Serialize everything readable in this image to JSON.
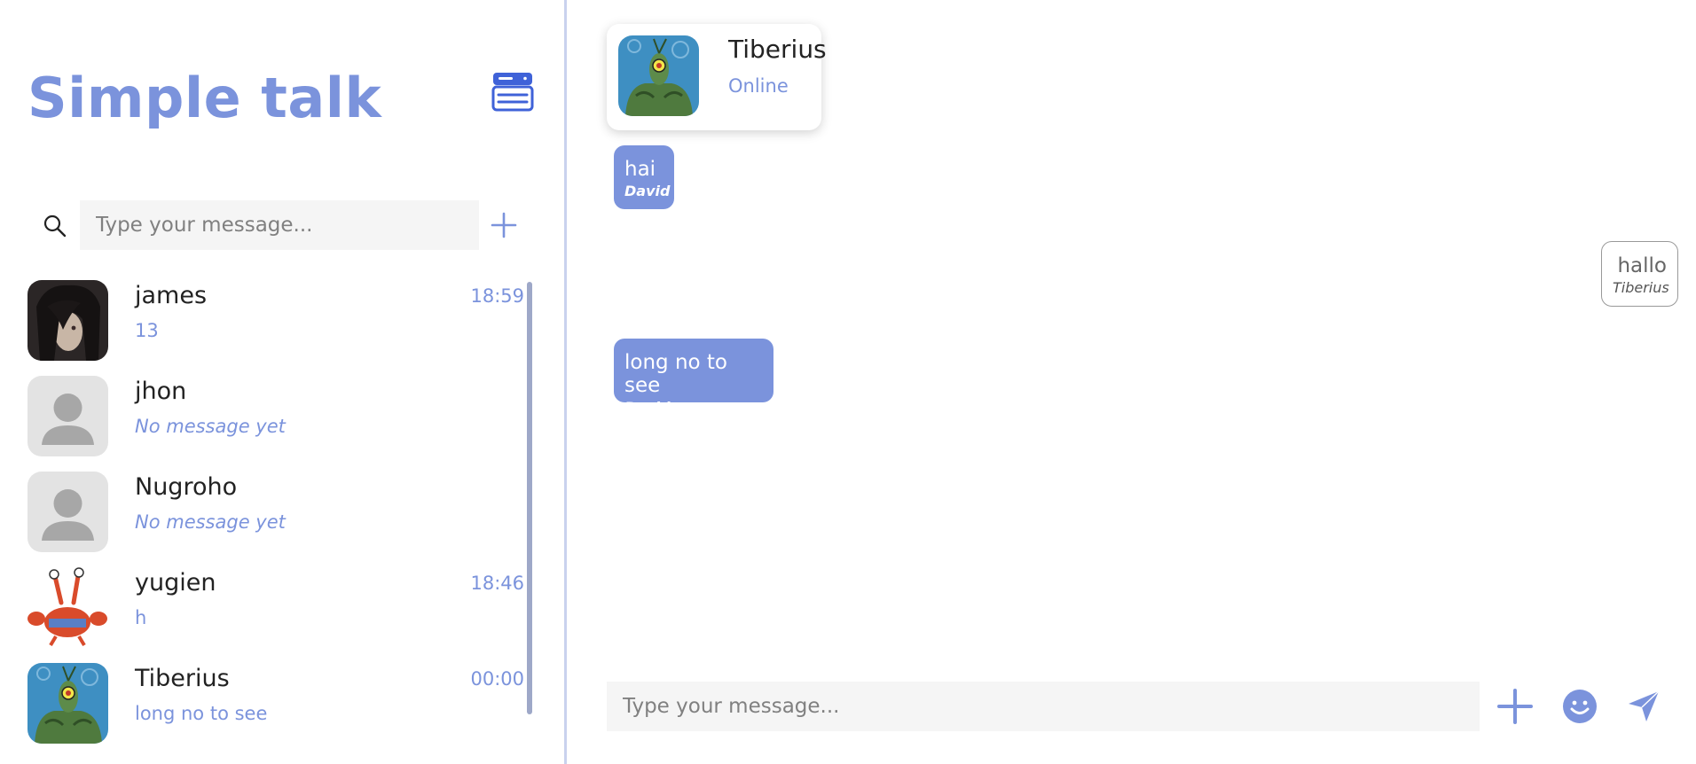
{
  "app": {
    "title": "Simple talk",
    "accent_color": "#7b93dc",
    "icon_color": "#3f62d8"
  },
  "sidebar": {
    "search": {
      "placeholder": "Type your message..."
    },
    "contacts": [
      {
        "name": "james",
        "preview": "13",
        "time": "18:59",
        "avatar": "dark-haired-character-avatar"
      },
      {
        "name": "jhon",
        "preview": "No message yet",
        "time": "",
        "avatar": "default-user-avatar"
      },
      {
        "name": "Nugroho",
        "preview": "No message yet",
        "time": "",
        "avatar": "default-user-avatar"
      },
      {
        "name": "yugien",
        "preview": "h",
        "time": "18:46",
        "avatar": "crab-character-avatar"
      },
      {
        "name": "Tiberius",
        "preview": "long no to see",
        "time": "00:00",
        "avatar": "plankton-character-avatar"
      }
    ]
  },
  "chat": {
    "header": {
      "name": "Tiberius",
      "status": "Online"
    },
    "messages": [
      {
        "text": "hai",
        "author": "David",
        "direction": "incoming"
      },
      {
        "text": "hallo",
        "author": "Tiberius",
        "direction": "outgoing"
      },
      {
        "text": "long no to see",
        "author": "David",
        "direction": "incoming"
      }
    ],
    "composer": {
      "placeholder": "Type your message..."
    }
  }
}
